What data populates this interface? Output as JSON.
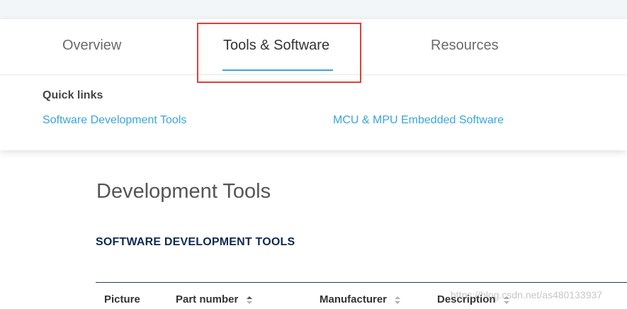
{
  "tabs": {
    "overview": "Overview",
    "tools_software": "Tools & Software",
    "resources": "Resources"
  },
  "quick_links": {
    "title": "Quick links",
    "items": [
      "Software Development Tools",
      "MCU & MPU Embedded Software"
    ]
  },
  "main": {
    "title": "Development Tools",
    "section_title": "SOFTWARE DEVELOPMENT TOOLS",
    "table": {
      "headers": [
        "Picture",
        "Part number",
        "Manufacturer",
        "Description"
      ]
    }
  },
  "watermark": "https://blog.csdn.net/as480133937",
  "colors": {
    "accent": "#3aa5d6",
    "highlight": "#e0403a",
    "section_title": "#0f2a4f"
  },
  "icons": {
    "sort": "sort-icon"
  }
}
